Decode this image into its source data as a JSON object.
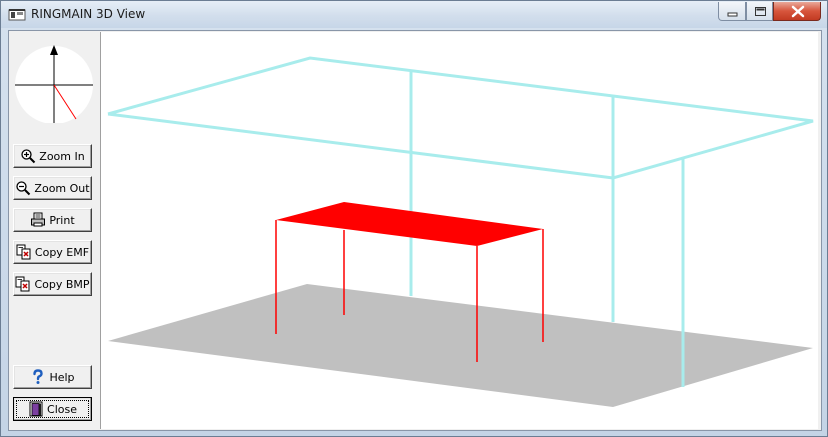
{
  "window": {
    "title": "RINGMAIN 3D View",
    "controls": [
      "minimize",
      "maximize",
      "close"
    ]
  },
  "toolbar": {
    "buttons": [
      {
        "id": "zoom_in",
        "label": "Zoom In",
        "icon": "zoom-in-icon"
      },
      {
        "id": "zoom_out",
        "label": "Zoom Out",
        "icon": "zoom-out-icon"
      },
      {
        "id": "print",
        "label": "Print",
        "icon": "printer-icon"
      },
      {
        "id": "copy_emf",
        "label": "Copy EMF",
        "icon": "copy-emf-icon"
      },
      {
        "id": "copy_bmp",
        "label": "Copy BMP",
        "icon": "copy-bmp-icon"
      },
      {
        "id": "help",
        "label": "Help",
        "icon": "help-icon"
      },
      {
        "id": "close",
        "label": "Close",
        "icon": "door-icon"
      }
    ]
  },
  "scene": {
    "colors": {
      "ceiling_frame": "#a8ecec",
      "table": "#ff0000",
      "floor": "#c0c0c0",
      "background": "#ffffff"
    }
  }
}
